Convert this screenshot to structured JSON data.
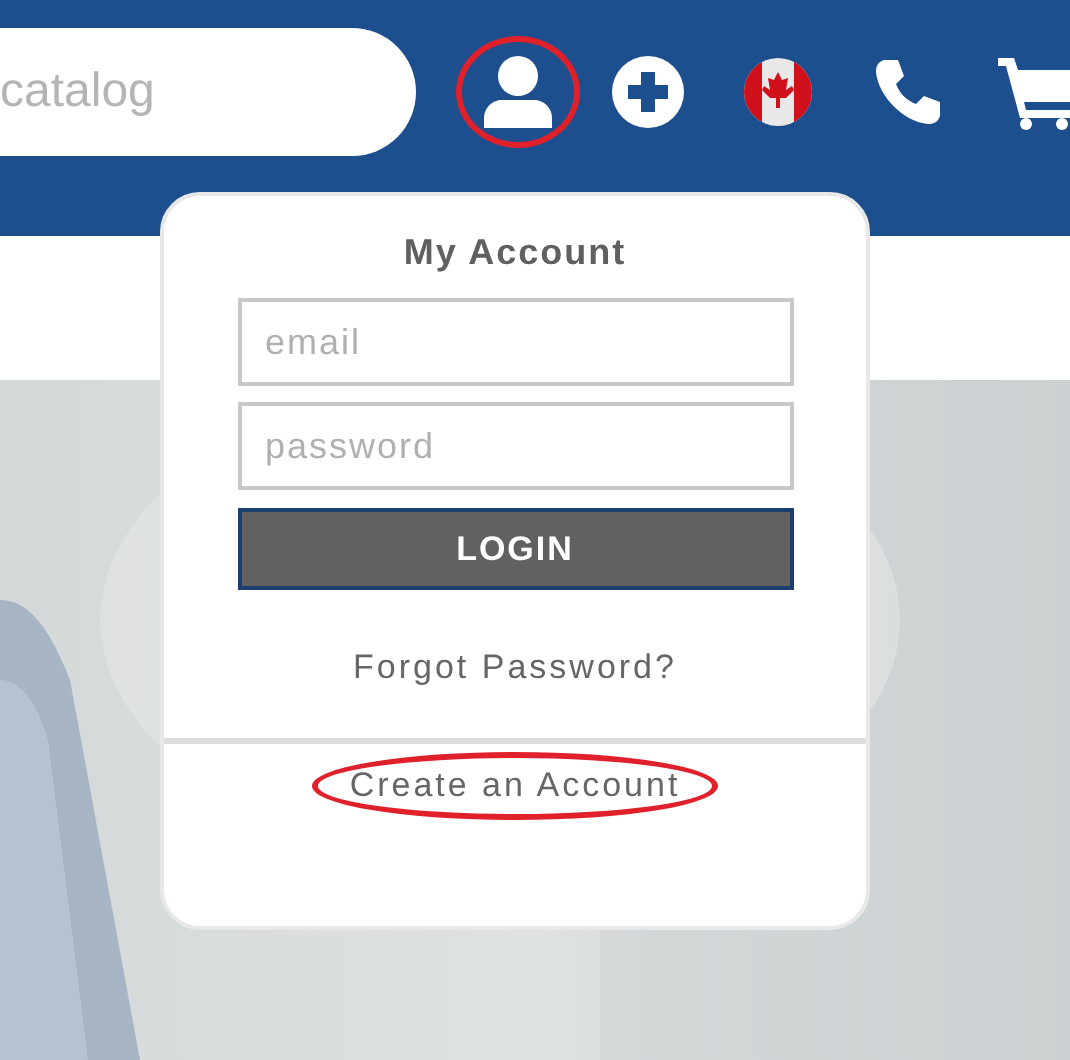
{
  "header": {
    "search": {
      "placeholder": "catalog"
    },
    "icons": [
      {
        "kind": "account",
        "circled": true
      },
      {
        "kind": "add",
        "circled": false
      },
      {
        "kind": "flag",
        "circled": false
      },
      {
        "kind": "phone",
        "circled": false
      },
      {
        "kind": "cart",
        "circled": false
      }
    ]
  },
  "account_menu": {
    "title": "My Account",
    "email": {
      "placeholder": "email"
    },
    "password": {
      "placeholder": "password"
    },
    "login_button": "LOGIN",
    "forgot_link": {
      "label": "Forgot Password?",
      "circled": false
    },
    "create_link": {
      "label": "Create an Account",
      "circled": true
    }
  }
}
